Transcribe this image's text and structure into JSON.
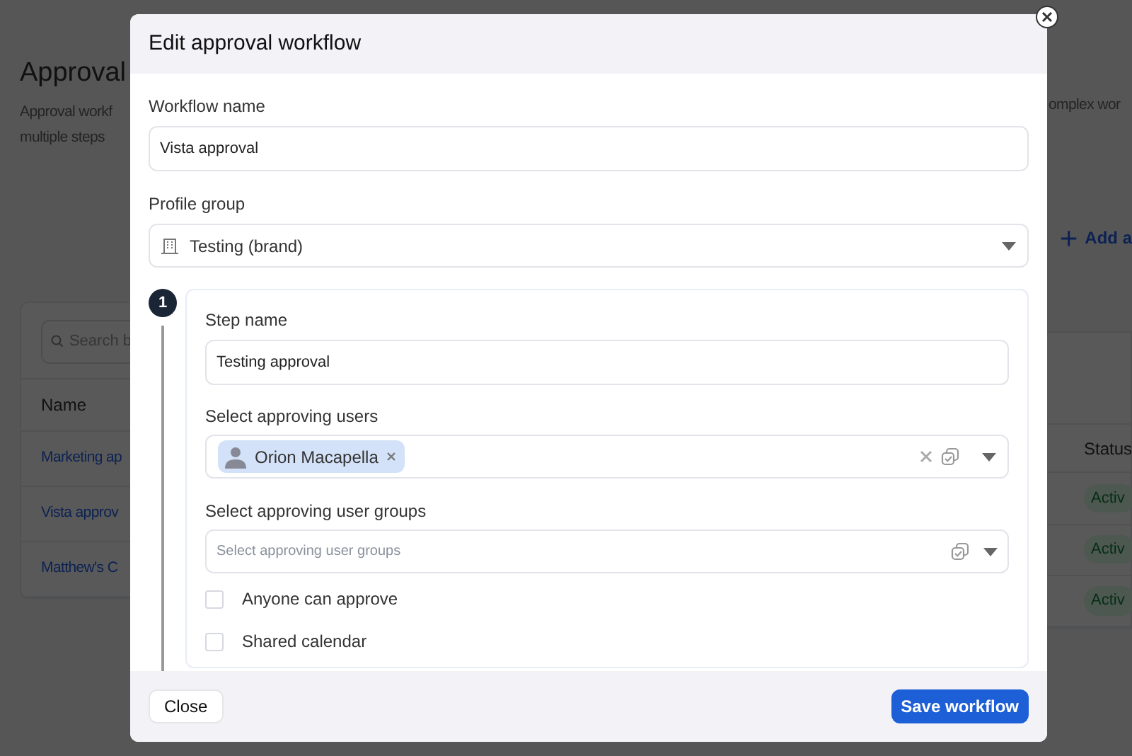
{
  "background_page": {
    "title": "Approval",
    "description_left": [
      "Approval workf",
      "multiple steps"
    ],
    "description_right": "omplex wor",
    "add_button": "Add a",
    "search": {
      "placeholder": "Search b"
    },
    "table": {
      "columns": [
        "Name",
        "Status"
      ],
      "rows": [
        {
          "name": "Marketing ap",
          "status": "Activ"
        },
        {
          "name": "Vista approv",
          "status": "Activ"
        },
        {
          "name": "Matthew's C",
          "status": "Activ"
        }
      ]
    }
  },
  "dialog": {
    "title": "Edit approval workflow",
    "workflow_name": {
      "label": "Workflow name",
      "value": "Vista approval"
    },
    "profile_group": {
      "label": "Profile group",
      "value": "Testing (brand)"
    },
    "steps": [
      {
        "number": "1",
        "step_name": {
          "label": "Step name",
          "value": "Testing approval"
        },
        "approving_users": {
          "label": "Select approving users",
          "chips": [
            "Orion Macapella"
          ]
        },
        "approving_user_groups": {
          "label": "Select approving user groups",
          "placeholder": "Select approving user groups"
        },
        "options": [
          {
            "label": "Anyone can approve",
            "checked": false
          },
          {
            "label": "Shared calendar",
            "checked": false
          }
        ]
      }
    ],
    "buttons": [
      {
        "label": "Close",
        "kind": "secondary"
      },
      {
        "label": "Save workflow",
        "kind": "primary"
      }
    ]
  }
}
